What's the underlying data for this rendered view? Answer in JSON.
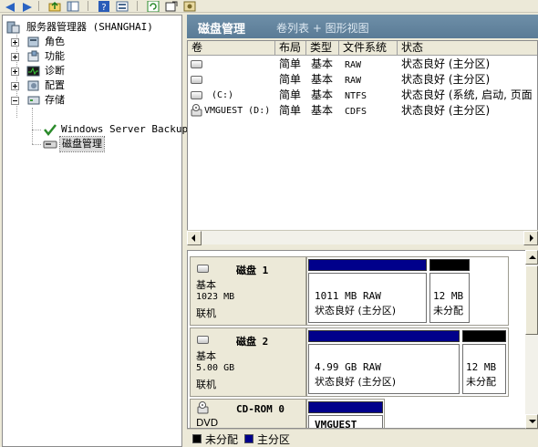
{
  "colors": {
    "primary_partition": "#00008b",
    "unallocated": "#000000",
    "header_bg": "#5f7f99",
    "selection_bg": "#dcdcdc"
  },
  "toolbar": {
    "icons": [
      "back-arrow",
      "forward-arrow",
      "up-folder",
      "show-hide-tree",
      "help",
      "properties",
      "refresh",
      "export",
      "settings"
    ]
  },
  "tree": {
    "root": "服务器管理器 (SHANGHAI)",
    "items": [
      {
        "label": "角色",
        "icon": "roles-icon"
      },
      {
        "label": "功能",
        "icon": "features-icon"
      },
      {
        "label": "诊断",
        "icon": "diagnostics-icon"
      },
      {
        "label": "配置",
        "icon": "configuration-icon"
      },
      {
        "label": "存储",
        "icon": "storage-icon"
      }
    ],
    "storage_children": [
      {
        "label": "Windows Server Backup",
        "icon": "backup-icon"
      },
      {
        "label": "磁盘管理",
        "icon": "disk-management-icon"
      }
    ]
  },
  "header": {
    "title": "磁盘管理",
    "subtitle": "卷列表 + 图形视图"
  },
  "volume_table": {
    "columns": [
      "卷",
      "布局",
      "类型",
      "文件系统",
      "状态"
    ],
    "rows": [
      {
        "volume": "",
        "layout": "简单",
        "type": "基本",
        "fs": "RAW",
        "status": "状态良好 (主分区)",
        "icon": "drive-icon"
      },
      {
        "volume": "",
        "layout": "简单",
        "type": "基本",
        "fs": "RAW",
        "status": "状态良好 (主分区)",
        "icon": "drive-icon"
      },
      {
        "volume": "(C:)",
        "layout": "简单",
        "type": "基本",
        "fs": "NTFS",
        "status": "状态良好 (系统, 启动, 页面",
        "icon": "drive-icon"
      },
      {
        "volume": "VMGUEST (D:)",
        "layout": "简单",
        "type": "基本",
        "fs": "CDFS",
        "status": "状态良好 (主分区)",
        "icon": "cd-drive-icon"
      }
    ]
  },
  "disks": [
    {
      "name": "磁盘 1",
      "type": "基本",
      "size": "1023 MB",
      "state": "联机",
      "partitions": [
        {
          "line1": "1011 MB RAW",
          "line2": "状态良好 (主分区)",
          "kind": "primary"
        },
        {
          "line1": "12 MB",
          "line2": "未分配",
          "kind": "unallocated"
        }
      ]
    },
    {
      "name": "磁盘 2",
      "type": "基本",
      "size": "5.00 GB",
      "state": "联机",
      "partitions": [
        {
          "line1": "4.99 GB RAW",
          "line2": "状态良好 (主分区)",
          "kind": "primary"
        },
        {
          "line1": "12 MB",
          "line2": "未分配",
          "kind": "unallocated"
        }
      ]
    },
    {
      "name": "CD-ROM 0",
      "type": "DVD",
      "partitions": [
        {
          "line1": "VMGUEST",
          "kind": "primary"
        }
      ]
    }
  ],
  "legend": [
    {
      "label": "未分配",
      "color": "#000000"
    },
    {
      "label": "主分区",
      "color": "#00008b"
    }
  ]
}
